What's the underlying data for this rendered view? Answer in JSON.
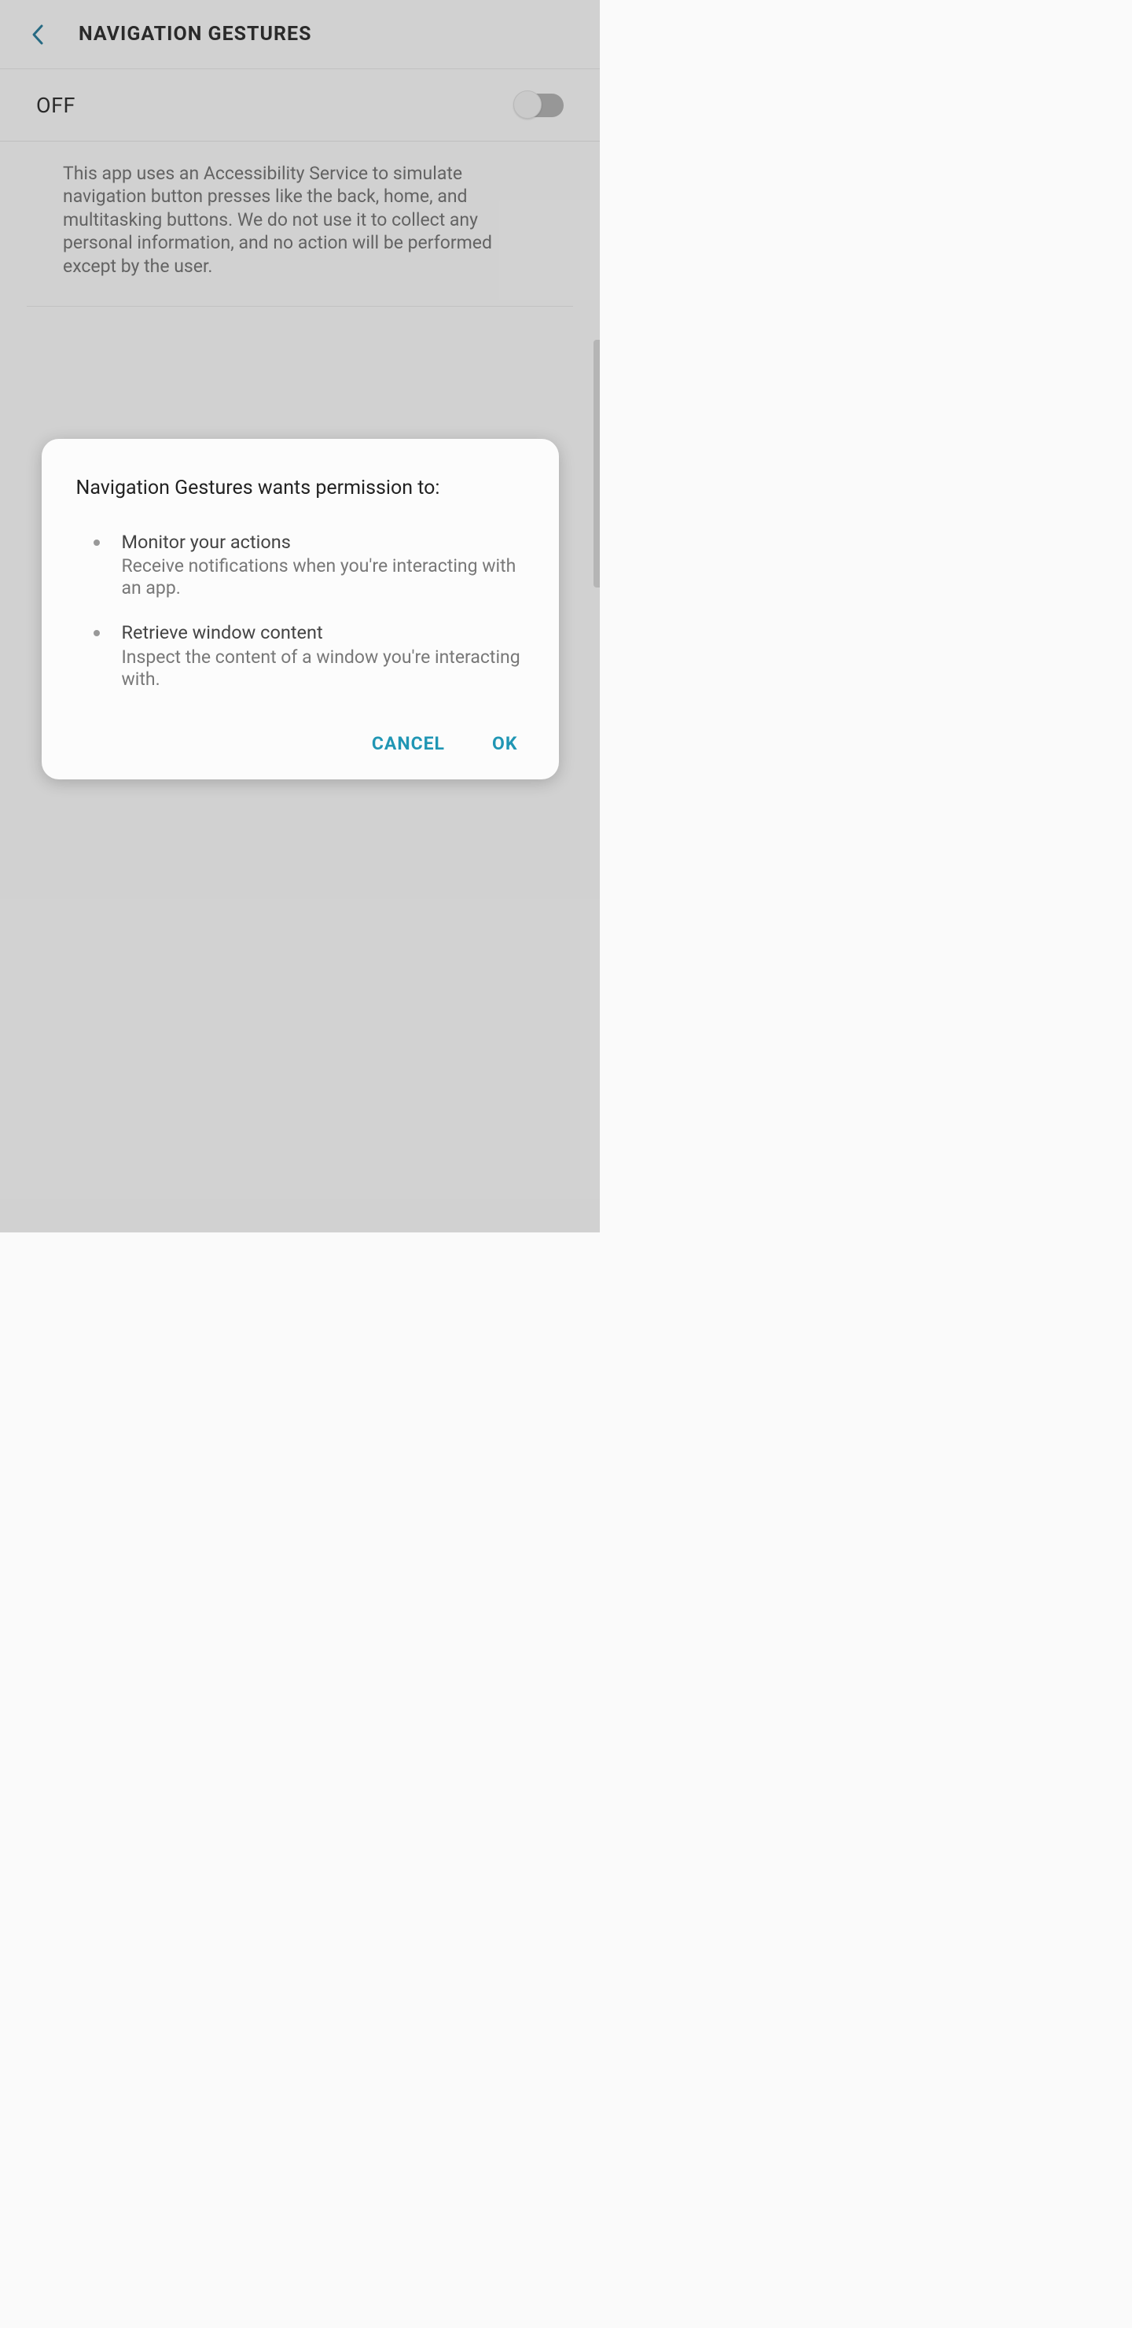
{
  "header": {
    "title": "NAVIGATION GESTURES"
  },
  "toggle": {
    "state_label": "OFF",
    "value": false
  },
  "description": "This app uses an Accessibility Service to simulate navigation button presses like the back, home, and multitasking buttons. We do not use it to collect any personal information, and no action will be performed except by the user.",
  "dialog": {
    "title": "Navigation Gestures wants permission to:",
    "permissions": [
      {
        "title": "Monitor your actions",
        "description": "Receive notifications when you're interacting with an app."
      },
      {
        "title": "Retrieve window content",
        "description": "Inspect the content of a window you're interacting with."
      }
    ],
    "cancel_label": "CANCEL",
    "ok_label": "OK"
  }
}
